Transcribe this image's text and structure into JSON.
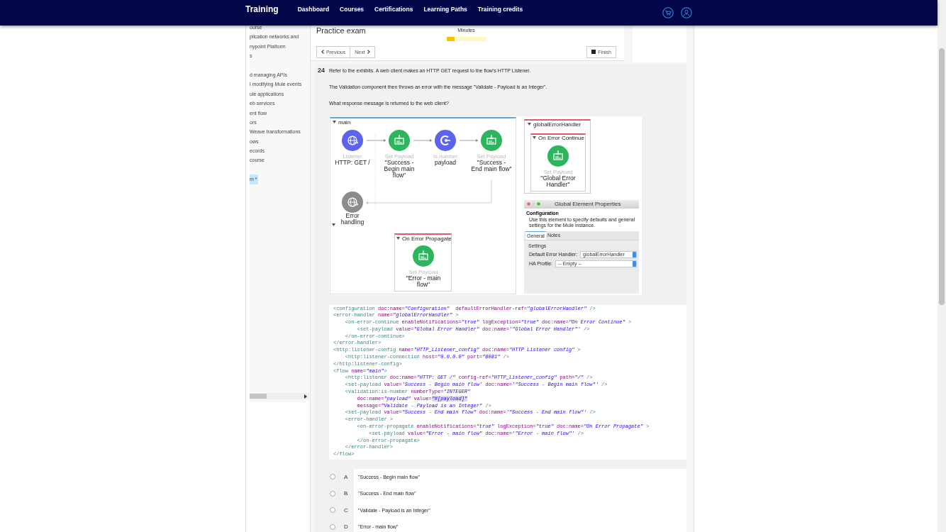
{
  "nav": {
    "brand": "Training",
    "links": [
      {
        "label": "Dashboard"
      },
      {
        "label": "Courses"
      },
      {
        "label": "Certifications"
      },
      {
        "label": "Learning Paths"
      },
      {
        "label": "Training credits"
      }
    ]
  },
  "sidebar": {
    "groups": [
      [
        {
          "label": "ourse",
          "selected": false
        },
        {
          "label": "plication networks and",
          "selected": false
        },
        {
          "label": "nypoint Platform",
          "selected": false
        },
        {
          "label": "s",
          "selected": false
        }
      ],
      [
        {
          "label": "d managing APIs",
          "selected": false
        },
        {
          "label": "l modifying Mule events",
          "selected": false
        },
        {
          "label": "ule applications",
          "selected": false
        },
        {
          "label": "eb services",
          "selected": false
        },
        {
          "label": "ent flow",
          "selected": false
        },
        {
          "label": "ors",
          "selected": false
        },
        {
          "label": "Weave transformations",
          "selected": false
        },
        {
          "label": "ows",
          "selected": false
        },
        {
          "label": "ecords",
          "selected": false
        },
        {
          "label": "course",
          "selected": false
        }
      ],
      [
        {
          "label": "m *",
          "selected": true
        }
      ]
    ]
  },
  "exam": {
    "title": "Practice exam",
    "timer_label": "Minutes",
    "timer": {
      "level": 0.2
    },
    "previous": "Previous",
    "next": "Next",
    "finish": "Finish"
  },
  "question": {
    "number": "24",
    "paragraphs": [
      "Refer to the exhibits. A web client makes an HTTP GET request to the flow's HTTP Listener.",
      "The Validation component then throws an error with the message \"Validate - Payload is an Integer\".",
      "What response message is returned to the web client?"
    ],
    "exhibit": {
      "main_flow": {
        "title": "main",
        "steps": [
          {
            "kind": "listener",
            "type": "Listener",
            "label": "HTTP: GET /"
          },
          {
            "kind": "set-payload",
            "type": "Set Payload",
            "label": "\"Success - Begin main flow\""
          },
          {
            "kind": "validator",
            "type": "Is number",
            "label": "payload"
          },
          {
            "kind": "set-payload",
            "type": "Set Payload",
            "label": "\"Success - End main flow\""
          }
        ],
        "error_section": {
          "kind": "listener-inactive",
          "label": "Error handling"
        },
        "error_handler": {
          "title": "On Error Propagate",
          "step": {
            "kind": "set-payload",
            "type": "Set Payload",
            "label": "\"Error - main flow\""
          }
        }
      },
      "global_handler": {
        "title": "globalErrorHandler",
        "scope": {
          "title": "On Error Continue",
          "step": {
            "kind": "set-payload",
            "type": "Set Payload",
            "label": "\"Global Error Handler\""
          }
        }
      },
      "properties_window": {
        "title": "Global Element Properties",
        "section": "Configuration",
        "description": "Use this element to specify defaults and general settings for the Mule instance.",
        "tabs": [
          {
            "label": "General",
            "selected": true
          },
          {
            "label": "Notes",
            "selected": false
          }
        ],
        "group": "Settings",
        "fields": [
          {
            "label": "Default Error Handler:",
            "value": "globalErrorHandler"
          },
          {
            "label": "HA Profile:",
            "value": "-- Empty --"
          }
        ]
      }
    },
    "code_lines": [
      [
        {
          "kind": "tag",
          "text": "<configuration"
        },
        {
          "kind": "attr",
          "text": " doc:name="
        },
        {
          "kind": "value",
          "text": "\"Configuration\""
        },
        {
          "kind": "attr",
          "text": "  defaultErrorHandler-ref="
        },
        {
          "kind": "value",
          "text": "\"globalErrorHandler\""
        },
        {
          "kind": "tag",
          "text": " />"
        }
      ],
      [
        {
          "kind": "tag",
          "text": "<error-handler"
        },
        {
          "kind": "attr",
          "text": " name="
        },
        {
          "kind": "value",
          "text": "\"globalErrorHandler\""
        },
        {
          "kind": "tag",
          "text": " >"
        }
      ],
      [
        {
          "kind": "tag",
          "text": "    <on-error-continue"
        },
        {
          "kind": "attr",
          "text": " enableNotifications="
        },
        {
          "kind": "value",
          "text": "\"true\""
        },
        {
          "kind": "attr",
          "text": " logException="
        },
        {
          "kind": "value",
          "text": "\"true\""
        },
        {
          "kind": "attr",
          "text": " doc:name="
        },
        {
          "kind": "value",
          "text": "\"On Error Continue\""
        },
        {
          "kind": "tag",
          "text": " >"
        }
      ],
      [
        {
          "kind": "tag",
          "text": "        <set-payload"
        },
        {
          "kind": "attr",
          "text": " value="
        },
        {
          "kind": "value",
          "text": "\"Global Error Handler\""
        },
        {
          "kind": "attr",
          "text": " doc:name="
        },
        {
          "kind": "value",
          "text": "'\"Global Error Handler\"'"
        },
        {
          "kind": "tag",
          "text": " />"
        }
      ],
      [
        {
          "kind": "tag",
          "text": "    </on-error-continue>"
        }
      ],
      [
        {
          "kind": "tag",
          "text": "</error-handler>"
        }
      ],
      [
        {
          "kind": "tag",
          "text": "<http:listener-config"
        },
        {
          "kind": "attr",
          "text": " name="
        },
        {
          "kind": "value",
          "text": "\"HTTP_Listener_config\""
        },
        {
          "kind": "attr",
          "text": " doc:name="
        },
        {
          "kind": "value",
          "text": "\"HTTP Listener config\""
        },
        {
          "kind": "tag",
          "text": " >"
        }
      ],
      [
        {
          "kind": "tag",
          "text": "    <http:listener-connection"
        },
        {
          "kind": "attr",
          "text": " host="
        },
        {
          "kind": "value",
          "text": "\"0.0.0.0\""
        },
        {
          "kind": "attr",
          "text": " port="
        },
        {
          "kind": "value",
          "text": "\"8081\""
        },
        {
          "kind": "tag",
          "text": " />"
        }
      ],
      [
        {
          "kind": "tag",
          "text": "</http:listener-config>"
        }
      ],
      [
        {
          "kind": "tag",
          "text": "<flow"
        },
        {
          "kind": "attr",
          "text": " name="
        },
        {
          "kind": "value",
          "text": "\"main\""
        },
        {
          "kind": "tag",
          "text": ">"
        }
      ],
      [
        {
          "kind": "tag",
          "text": "    <http:listener"
        },
        {
          "kind": "attr",
          "text": " doc:name="
        },
        {
          "kind": "value",
          "text": "\"HTTP: GET /\""
        },
        {
          "kind": "attr",
          "text": " config-ref="
        },
        {
          "kind": "value",
          "text": "\"HTTP_Listener_config\""
        },
        {
          "kind": "attr",
          "text": " path="
        },
        {
          "kind": "value",
          "text": "\"/\""
        },
        {
          "kind": "tag",
          "text": " />"
        }
      ],
      [
        {
          "kind": "tag",
          "text": "    <set-payload"
        },
        {
          "kind": "attr",
          "text": " value="
        },
        {
          "kind": "value",
          "text": "'Success - Begin main flow'"
        },
        {
          "kind": "attr",
          "text": " doc:name="
        },
        {
          "kind": "value",
          "text": "'\"Success - Begin main flow\"'"
        },
        {
          "kind": "tag",
          "text": " />"
        }
      ],
      [
        {
          "kind": "tag",
          "text": "    <validation:is-number"
        },
        {
          "kind": "attr",
          "text": " numberType="
        },
        {
          "kind": "value",
          "text": "\"INTEGER\""
        }
      ],
      [
        {
          "kind": "attr",
          "text": "        doc:name="
        },
        {
          "kind": "value",
          "text": "\"payload\""
        },
        {
          "kind": "attr",
          "text": " value="
        },
        {
          "kind": "selected-value",
          "text": "\"#[payload]\""
        }
      ],
      [
        {
          "kind": "attr",
          "text": "        message="
        },
        {
          "kind": "value",
          "text": "\"Validate - Payload is an Integer\""
        },
        {
          "kind": "tag",
          "text": " />"
        }
      ],
      [
        {
          "kind": "tag",
          "text": "    <set-payload"
        },
        {
          "kind": "attr",
          "text": " value="
        },
        {
          "kind": "value",
          "text": "\"Success - End main flow\""
        },
        {
          "kind": "attr",
          "text": " doc:name="
        },
        {
          "kind": "value",
          "text": "'\"Success - End main flow\"'"
        },
        {
          "kind": "tag",
          "text": " />"
        }
      ],
      [
        {
          "kind": "tag",
          "text": "    <error-handler >"
        }
      ],
      [
        {
          "kind": "tag",
          "text": "        <on-error-propagate"
        },
        {
          "kind": "attr",
          "text": " enableNotifications="
        },
        {
          "kind": "value",
          "text": "\"true\""
        },
        {
          "kind": "attr",
          "text": " logException="
        },
        {
          "kind": "value",
          "text": "\"true\""
        },
        {
          "kind": "attr",
          "text": " doc:name="
        },
        {
          "kind": "value",
          "text": "\"On Error Propagate\""
        },
        {
          "kind": "tag",
          "text": " >"
        }
      ],
      [
        {
          "kind": "tag",
          "text": "            <set-payload"
        },
        {
          "kind": "attr",
          "text": " value="
        },
        {
          "kind": "value",
          "text": "\"Error - main flow\""
        },
        {
          "kind": "attr",
          "text": " doc:name="
        },
        {
          "kind": "value",
          "text": "'\"Error - main flow\"'"
        },
        {
          "kind": "tag",
          "text": " />"
        }
      ],
      [
        {
          "kind": "tag",
          "text": "        </on-error-propagate>"
        }
      ],
      [
        {
          "kind": "tag",
          "text": "    </error-handler>"
        }
      ],
      [
        {
          "kind": "tag",
          "text": "</flow>"
        }
      ]
    ],
    "options": [
      {
        "letter": "A",
        "text": "\"Success - Begin main flow\"",
        "selected": false
      },
      {
        "letter": "B",
        "text": "\"Success - End main flow\"",
        "selected": false
      },
      {
        "letter": "C",
        "text": "\"Validate - Payload is an Integer\"",
        "selected": false
      },
      {
        "letter": "D",
        "text": "\"Error - main flow\"",
        "selected": false
      }
    ]
  }
}
